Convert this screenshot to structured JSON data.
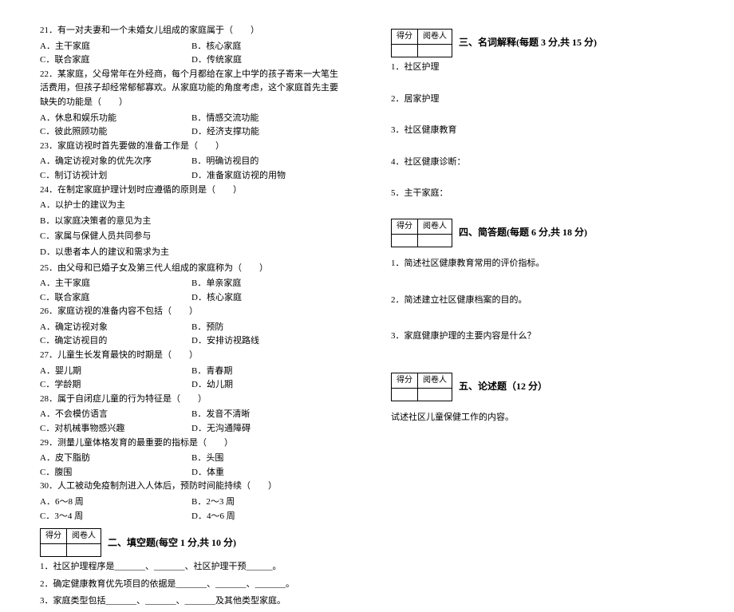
{
  "scoreBox": {
    "scoreLabel": "得分",
    "graderLabel": "阅卷人"
  },
  "left": {
    "q21": "21．有一对夫妻和一个未婚女儿组成的家庭属于（　　）",
    "q21a": "A．主干家庭",
    "q21b": "B．核心家庭",
    "q21c": "C．联合家庭",
    "q21d": "D．传统家庭",
    "q22": "22．某家庭，父母常年在外经商，每个月都给在家上中学的孩子寄来一大笔生活费用，但孩子却经常郁郁寡欢。从家庭功能的角度考虑，这个家庭首先主要缺失的功能是（　　）",
    "q22a": "A．休息和娱乐功能",
    "q22b": "B．情感交流功能",
    "q22c": "C．彼此照顾功能",
    "q22d": "D．经济支撑功能",
    "q23": "23．家庭访视时首先要做的准备工作是（　　）",
    "q23a": "A．确定访视对象的优先次序",
    "q23b": "B．明确访视目的",
    "q23c": "C．制订访视计划",
    "q23d": "D．准备家庭访视的用物",
    "q24": "24．在制定家庭护理计划时应遵循的原则是（　　）",
    "q24a": "A．以护士的建议为主",
    "q24b": "B．以家庭决策者的意见为主",
    "q24c": "C．家属与保健人员共同参与",
    "q24d": "D．以患者本人的建议和需求为主",
    "q25": "25．由父母和已婚子女及第三代人组成的家庭称为（　　）",
    "q25a": "A．主干家庭",
    "q25b": "B．单亲家庭",
    "q25c": "C．联合家庭",
    "q25d": "D．核心家庭",
    "q26": "26．家庭访视的准备内容不包括（　　）",
    "q26a": "A．确定访视对象",
    "q26b": "B．预防",
    "q26c": "C．确定访视目的",
    "q26d": "D．安排访视路线",
    "q27": "27．儿童生长发育最快的时期是（　　）",
    "q27a": "A．婴儿期",
    "q27b": "B．青春期",
    "q27c": "C．学龄期",
    "q27d": "D．幼儿期",
    "q28": "28．属于自闭症儿童的行为特征是（　　）",
    "q28a": "A．不会模仿语言",
    "q28b": "B．发音不清晰",
    "q28c": "C．对机械事物感兴趣",
    "q28d": "D．无沟通障碍",
    "q29": "29．测量儿童体格发育的最重要的指标是（　　）",
    "q29a": "A．皮下脂肪",
    "q29b": "B．头围",
    "q29c": "C．腹围",
    "q29d": "D．体重",
    "q30": "30．人工被动免疫制剂进入人体后，预防时间能持续（　　）",
    "q30a": "A．6～8 周",
    "q30b": "B．2～3 周",
    "q30c": "C．3～4 周",
    "q30d": "D．4～6 周",
    "sec2": "二、填空题(每空 1 分,共 10 分)",
    "f1": "1．社区护理程序是_______、_______、社区护理干预______。",
    "f2": "2．确定健康教育优先项目的依据是_______、_______、_______。",
    "f3": "3．家庭类型包括_______、_______、_______及其他类型家庭。"
  },
  "right": {
    "sec3": "三、名词解释(每题 3 分,共 15 分)",
    "n1": "1．社区护理",
    "n2": "2．居家护理",
    "n3": "3．社区健康教育",
    "n4": "4．社区健康诊断：",
    "n5": "5．主干家庭：",
    "sec4": "四、简答题(每题 6 分,共 18 分)",
    "s1": "1．简述社区健康教育常用的评价指标。",
    "s2": "2．简述建立社区健康档案的目的。",
    "s3": "3．家庭健康护理的主要内容是什么？",
    "sec5": "五、论述题（12 分）",
    "e1": "试述社区儿童保健工作的内容。"
  }
}
